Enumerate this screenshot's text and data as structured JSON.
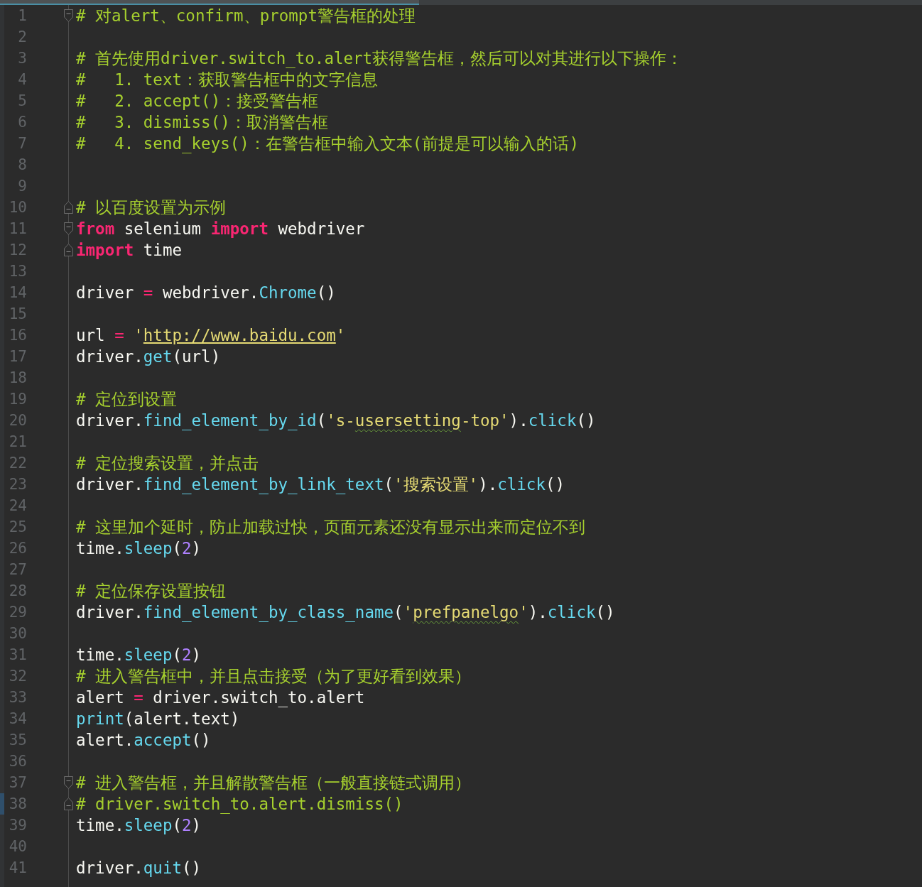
{
  "editor": {
    "lines": [
      {
        "number": "1",
        "fold_start": true,
        "tokens": [
          {
            "kind": "comment",
            "text": "# 对alert、confirm、prompt警告框的处理"
          }
        ]
      },
      {
        "number": "2"
      },
      {
        "number": "3",
        "tokens": [
          {
            "kind": "comment",
            "text": "# 首先使用driver.switch_to.alert获得警告框，然后可以对其进行以下操作："
          }
        ]
      },
      {
        "number": "4",
        "tokens": [
          {
            "kind": "comment",
            "text": "#   1. text：获取警告框中的文字信息"
          }
        ]
      },
      {
        "number": "5",
        "tokens": [
          {
            "kind": "comment",
            "text": "#   2. accept()：接受警告框"
          }
        ]
      },
      {
        "number": "6",
        "tokens": [
          {
            "kind": "comment",
            "text": "#   3. dismiss()：取消警告框"
          }
        ]
      },
      {
        "number": "7",
        "tokens": [
          {
            "kind": "comment",
            "text": "#   4. send_keys()：在警告框中输入文本(前提是可以输入的话)"
          }
        ]
      },
      {
        "number": "8"
      },
      {
        "number": "9"
      },
      {
        "number": "10",
        "fold_end": true,
        "tokens": [
          {
            "kind": "comment",
            "text": "# 以百度设置为示例"
          }
        ]
      },
      {
        "number": "11",
        "fold_start": true,
        "tokens": [
          {
            "kind": "keyword",
            "text": "from"
          },
          {
            "kind": "plain",
            "text": " selenium "
          },
          {
            "kind": "keyword",
            "text": "import"
          },
          {
            "kind": "plain",
            "text": " webdriver"
          }
        ]
      },
      {
        "number": "12",
        "fold_end": true,
        "tokens": [
          {
            "kind": "keyword",
            "text": "import"
          },
          {
            "kind": "plain",
            "text": " time"
          }
        ]
      },
      {
        "number": "13"
      },
      {
        "number": "14",
        "tokens": [
          {
            "kind": "plain",
            "text": "driver "
          },
          {
            "kind": "operator",
            "text": "="
          },
          {
            "kind": "plain",
            "text": " webdriver."
          },
          {
            "kind": "method",
            "text": "Chrome"
          },
          {
            "kind": "plain",
            "text": "()"
          }
        ]
      },
      {
        "number": "15"
      },
      {
        "number": "16",
        "tokens": [
          {
            "kind": "plain",
            "text": "url "
          },
          {
            "kind": "operator",
            "text": "="
          },
          {
            "kind": "string",
            "text": " '"
          },
          {
            "kind": "string",
            "text": "http://www.baidu.com",
            "link": true
          },
          {
            "kind": "string",
            "text": "'"
          }
        ]
      },
      {
        "number": "17",
        "tokens": [
          {
            "kind": "plain",
            "text": "driver."
          },
          {
            "kind": "method",
            "text": "get"
          },
          {
            "kind": "plain",
            "text": "(url)"
          }
        ]
      },
      {
        "number": "18"
      },
      {
        "number": "19",
        "tokens": [
          {
            "kind": "comment",
            "text": "# 定位到设置"
          }
        ]
      },
      {
        "number": "20",
        "tokens": [
          {
            "kind": "plain",
            "text": "driver."
          },
          {
            "kind": "method",
            "text": "find_element_by_id"
          },
          {
            "kind": "plain",
            "text": "("
          },
          {
            "kind": "string",
            "text": "'s-"
          },
          {
            "kind": "string",
            "text": "usersetting",
            "typo": true
          },
          {
            "kind": "string",
            "text": "-top'"
          },
          {
            "kind": "plain",
            "text": ")."
          },
          {
            "kind": "method",
            "text": "click"
          },
          {
            "kind": "plain",
            "text": "()"
          }
        ]
      },
      {
        "number": "21"
      },
      {
        "number": "22",
        "tokens": [
          {
            "kind": "comment",
            "text": "# 定位搜索设置，并点击"
          }
        ]
      },
      {
        "number": "23",
        "tokens": [
          {
            "kind": "plain",
            "text": "driver."
          },
          {
            "kind": "method",
            "text": "find_element_by_link_text"
          },
          {
            "kind": "plain",
            "text": "("
          },
          {
            "kind": "string",
            "text": "'搜索设置'"
          },
          {
            "kind": "plain",
            "text": ")."
          },
          {
            "kind": "method",
            "text": "click"
          },
          {
            "kind": "plain",
            "text": "()"
          }
        ]
      },
      {
        "number": "24"
      },
      {
        "number": "25",
        "tokens": [
          {
            "kind": "comment",
            "text": "# 这里加个延时，防止加载过快，页面元素还没有显示出来而定位不到"
          }
        ]
      },
      {
        "number": "26",
        "tokens": [
          {
            "kind": "plain",
            "text": "time."
          },
          {
            "kind": "method",
            "text": "sleep"
          },
          {
            "kind": "plain",
            "text": "("
          },
          {
            "kind": "number",
            "text": "2"
          },
          {
            "kind": "plain",
            "text": ")"
          }
        ]
      },
      {
        "number": "27"
      },
      {
        "number": "28",
        "tokens": [
          {
            "kind": "comment",
            "text": "# 定位保存设置按钮"
          }
        ]
      },
      {
        "number": "29",
        "tokens": [
          {
            "kind": "plain",
            "text": "driver."
          },
          {
            "kind": "method",
            "text": "find_element_by_class_name"
          },
          {
            "kind": "plain",
            "text": "("
          },
          {
            "kind": "string",
            "text": "'"
          },
          {
            "kind": "string",
            "text": "prefpanelgo",
            "typo": true
          },
          {
            "kind": "string",
            "text": "'"
          },
          {
            "kind": "plain",
            "text": ")."
          },
          {
            "kind": "method",
            "text": "click"
          },
          {
            "kind": "plain",
            "text": "()"
          }
        ]
      },
      {
        "number": "30"
      },
      {
        "number": "31",
        "tokens": [
          {
            "kind": "plain",
            "text": "time."
          },
          {
            "kind": "method",
            "text": "sleep"
          },
          {
            "kind": "plain",
            "text": "("
          },
          {
            "kind": "number",
            "text": "2"
          },
          {
            "kind": "plain",
            "text": ")"
          }
        ]
      },
      {
        "number": "32",
        "tokens": [
          {
            "kind": "comment",
            "text": "# 进入警告框中，并且点击接受（为了更好看到效果）"
          }
        ]
      },
      {
        "number": "33",
        "tokens": [
          {
            "kind": "plain",
            "text": "alert "
          },
          {
            "kind": "operator",
            "text": "="
          },
          {
            "kind": "plain",
            "text": " driver.switch_to.alert"
          }
        ]
      },
      {
        "number": "34",
        "tokens": [
          {
            "kind": "method",
            "text": "print"
          },
          {
            "kind": "plain",
            "text": "(alert.text)"
          }
        ]
      },
      {
        "number": "35",
        "tokens": [
          {
            "kind": "plain",
            "text": "alert."
          },
          {
            "kind": "method",
            "text": "accept"
          },
          {
            "kind": "plain",
            "text": "()"
          }
        ]
      },
      {
        "number": "36"
      },
      {
        "number": "37",
        "fold_start": true,
        "tokens": [
          {
            "kind": "comment",
            "text": "# 进入警告框，并且解散警告框（一般直接链式调用）"
          }
        ]
      },
      {
        "number": "38",
        "fold_end": true,
        "current": true,
        "tokens": [
          {
            "kind": "comment",
            "text": "# driver.switch_to.alert.dismiss()"
          }
        ]
      },
      {
        "number": "39",
        "tokens": [
          {
            "kind": "plain",
            "text": "time."
          },
          {
            "kind": "method",
            "text": "sleep"
          },
          {
            "kind": "plain",
            "text": "("
          },
          {
            "kind": "number",
            "text": "2"
          },
          {
            "kind": "plain",
            "text": ")"
          }
        ]
      },
      {
        "number": "40"
      },
      {
        "number": "41",
        "tokens": [
          {
            "kind": "plain",
            "text": "driver."
          },
          {
            "kind": "method",
            "text": "quit"
          },
          {
            "kind": "plain",
            "text": "()"
          }
        ]
      }
    ]
  }
}
